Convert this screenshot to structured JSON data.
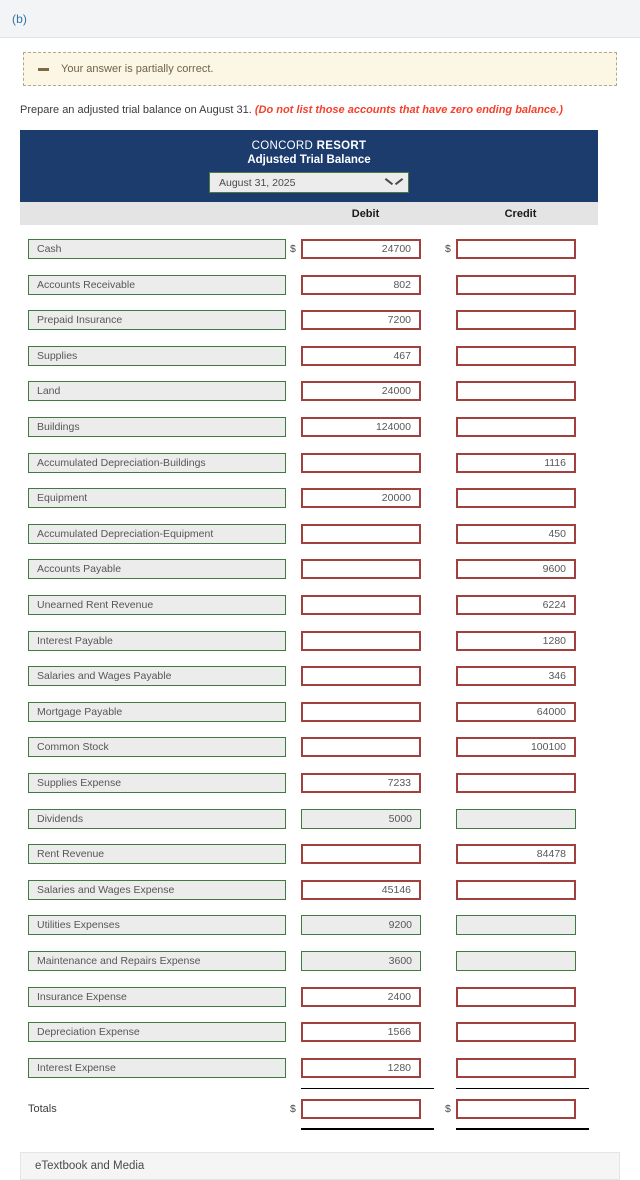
{
  "part": {
    "label": "(b)"
  },
  "alert": {
    "icon": "minus-icon",
    "message": "Your answer is partially correct."
  },
  "instruction": {
    "main": "Prepare an adjusted trial balance on August 31.",
    "emphasis": "(Do not list those accounts that have zero ending balance.)"
  },
  "statement": {
    "company_normal": "CONCORD ",
    "company_bold": "RESORT",
    "title": "Adjusted Trial Balance",
    "date_select": {
      "value": "August 31, 2025",
      "icon": "chevron-down-icon"
    },
    "columns": {
      "account": "",
      "debit": "Debit",
      "credit": "Credit"
    },
    "currency_symbol": "$",
    "rows": [
      {
        "account": "Cash",
        "debit": "24700",
        "credit": "",
        "debit_state": "wrong",
        "credit_state": "wrong",
        "acct_state": "ok",
        "show_dollar": true
      },
      {
        "account": "Accounts Receivable",
        "debit": "802",
        "credit": "",
        "debit_state": "wrong",
        "credit_state": "wrong",
        "acct_state": "ok",
        "show_dollar": false
      },
      {
        "account": "Prepaid Insurance",
        "debit": "7200",
        "credit": "",
        "debit_state": "wrong",
        "credit_state": "wrong",
        "acct_state": "ok",
        "show_dollar": false
      },
      {
        "account": "Supplies",
        "debit": "467",
        "credit": "",
        "debit_state": "wrong",
        "credit_state": "wrong",
        "acct_state": "ok",
        "show_dollar": false
      },
      {
        "account": "Land",
        "debit": "24000",
        "credit": "",
        "debit_state": "wrong",
        "credit_state": "wrong",
        "acct_state": "ok",
        "show_dollar": false
      },
      {
        "account": "Buildings",
        "debit": "124000",
        "credit": "",
        "debit_state": "wrong",
        "credit_state": "wrong",
        "acct_state": "ok",
        "show_dollar": false
      },
      {
        "account": "Accumulated Depreciation-Buildings",
        "debit": "",
        "credit": "1116",
        "debit_state": "wrong",
        "credit_state": "wrong",
        "acct_state": "ok",
        "show_dollar": false
      },
      {
        "account": "Equipment",
        "debit": "20000",
        "credit": "",
        "debit_state": "wrong",
        "credit_state": "wrong",
        "acct_state": "ok",
        "show_dollar": false
      },
      {
        "account": "Accumulated Depreciation-Equipment",
        "debit": "",
        "credit": "450",
        "debit_state": "wrong",
        "credit_state": "wrong",
        "acct_state": "ok",
        "show_dollar": false
      },
      {
        "account": "Accounts Payable",
        "debit": "",
        "credit": "9600",
        "debit_state": "wrong",
        "credit_state": "wrong",
        "acct_state": "ok",
        "show_dollar": false
      },
      {
        "account": "Unearned Rent Revenue",
        "debit": "",
        "credit": "6224",
        "debit_state": "wrong",
        "credit_state": "wrong",
        "acct_state": "ok",
        "show_dollar": false
      },
      {
        "account": "Interest Payable",
        "debit": "",
        "credit": "1280",
        "debit_state": "wrong",
        "credit_state": "wrong",
        "acct_state": "ok",
        "show_dollar": false
      },
      {
        "account": "Salaries and Wages Payable",
        "debit": "",
        "credit": "346",
        "debit_state": "wrong",
        "credit_state": "wrong",
        "acct_state": "ok",
        "show_dollar": false
      },
      {
        "account": "Mortgage Payable",
        "debit": "",
        "credit": "64000",
        "debit_state": "wrong",
        "credit_state": "wrong",
        "acct_state": "ok",
        "show_dollar": false
      },
      {
        "account": "Common Stock",
        "debit": "",
        "credit": "100100",
        "debit_state": "wrong",
        "credit_state": "wrong",
        "acct_state": "ok",
        "show_dollar": false
      },
      {
        "account": "Supplies Expense",
        "debit": "7233",
        "credit": "",
        "debit_state": "wrong",
        "credit_state": "wrong",
        "acct_state": "ok",
        "show_dollar": false
      },
      {
        "account": "Dividends",
        "debit": "5000",
        "credit": "",
        "debit_state": "ok",
        "credit_state": "ok",
        "acct_state": "ok",
        "show_dollar": false
      },
      {
        "account": "Rent Revenue",
        "debit": "",
        "credit": "84478",
        "debit_state": "wrong",
        "credit_state": "wrong",
        "acct_state": "ok",
        "show_dollar": false
      },
      {
        "account": "Salaries and Wages Expense",
        "debit": "45146",
        "credit": "",
        "debit_state": "wrong",
        "credit_state": "wrong",
        "acct_state": "ok",
        "show_dollar": false
      },
      {
        "account": "Utilities Expenses",
        "debit": "9200",
        "credit": "",
        "debit_state": "ok",
        "credit_state": "ok",
        "acct_state": "ok",
        "show_dollar": false
      },
      {
        "account": "Maintenance and Repairs Expense",
        "debit": "3600",
        "credit": "",
        "debit_state": "ok",
        "credit_state": "ok",
        "acct_state": "ok",
        "show_dollar": false
      },
      {
        "account": "Insurance Expense",
        "debit": "2400",
        "credit": "",
        "debit_state": "wrong",
        "credit_state": "wrong",
        "acct_state": "ok",
        "show_dollar": false
      },
      {
        "account": "Depreciation Expense",
        "debit": "1566",
        "credit": "",
        "debit_state": "wrong",
        "credit_state": "wrong",
        "acct_state": "ok",
        "show_dollar": false
      },
      {
        "account": "Interest Expense",
        "debit": "1280",
        "credit": "",
        "debit_state": "wrong",
        "credit_state": "wrong",
        "acct_state": "ok",
        "show_dollar": false
      }
    ],
    "totals": {
      "label": "Totals",
      "debit": "",
      "credit": "",
      "debit_state": "wrong",
      "credit_state": "wrong"
    }
  },
  "footer": {
    "etextbook_label": "eTextbook and Media"
  },
  "colors": {
    "header_navy": "#1c3c6e",
    "error_border": "#a0413e",
    "ok_border": "#3f7a3f",
    "field_fill": "#ececec",
    "alert_bg": "#fbf7e4",
    "emphasis_red": "#f5402c",
    "part_label_blue": "#2f72a8"
  }
}
